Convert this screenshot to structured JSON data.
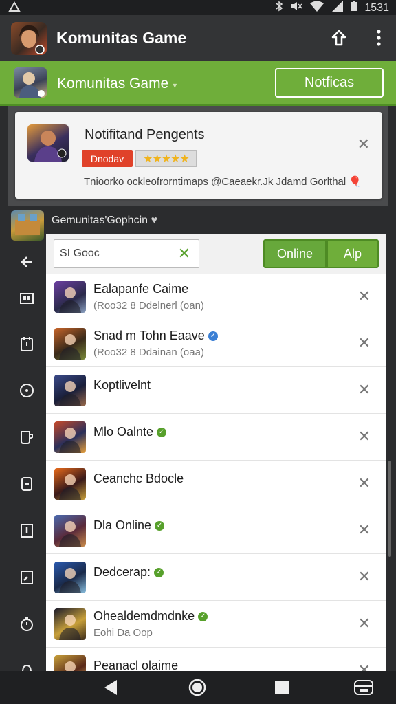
{
  "status": {
    "time": "1531",
    "icons": [
      "bluetooth-icon",
      "mute-icon",
      "wifi-icon",
      "signal-icon",
      "battery-icon"
    ]
  },
  "appbar": {
    "title": "Komunitas Game",
    "actions": [
      "share-icon",
      "more-icon"
    ]
  },
  "greenbar": {
    "title": "Komunitas Game",
    "notif_button": "Notficas"
  },
  "card": {
    "title": "Notifitand Pengents",
    "badge": "Dnodav",
    "stars": "★★★★★",
    "text": "Tnioorko ockleofrorntimaps @Caeaekr.Jk Jdamd Gorlthal 🎈"
  },
  "community": {
    "label": "Gemunitas'Gophcin",
    "heart": "♥"
  },
  "toolbar": {
    "search_value": "SI Gooc",
    "online_label": "Online",
    "all_label": "Alp"
  },
  "friends": [
    {
      "name": "Ealapanfe Caime",
      "sub": "(Roo32 8 Ddelnerl (oan)",
      "badge": "",
      "badge_color": ""
    },
    {
      "name": "Snad m Tohn Eaave",
      "sub": "(Roo32 8 Ddainan (oaa)",
      "badge": "✓",
      "badge_color": "#3b7fd4"
    },
    {
      "name": "Koptlivelnt",
      "sub": "",
      "badge": "",
      "badge_color": ""
    },
    {
      "name": "Mlo Oalnte",
      "sub": "",
      "badge": "✓",
      "badge_color": "#57a02b"
    },
    {
      "name": "Ceanchc Bdocle",
      "sub": "",
      "badge": "",
      "badge_color": ""
    },
    {
      "name": "Dla Online",
      "sub": "",
      "badge": "✓",
      "badge_color": "#57a02b"
    },
    {
      "name": "Dedcerap:",
      "sub": "",
      "badge": "✓",
      "badge_color": "#57a02b"
    },
    {
      "name": "Ohealdemdmdnke",
      "sub": "Eohi Da Oop",
      "badge": "✓",
      "badge_color": "#57a02b"
    },
    {
      "name": "Peanacl olaime",
      "sub": "",
      "badge": "",
      "badge_color": ""
    }
  ],
  "sidebar": [
    "back-arrow-icon",
    "controller-icon",
    "calendar-icon",
    "target-icon",
    "cup-icon",
    "document-icon",
    "info-icon",
    "chart-icon",
    "timer-icon",
    "more-icon"
  ],
  "colors": {
    "accent_green": "#6fae3a",
    "dark_bg": "#2b2c2e"
  }
}
